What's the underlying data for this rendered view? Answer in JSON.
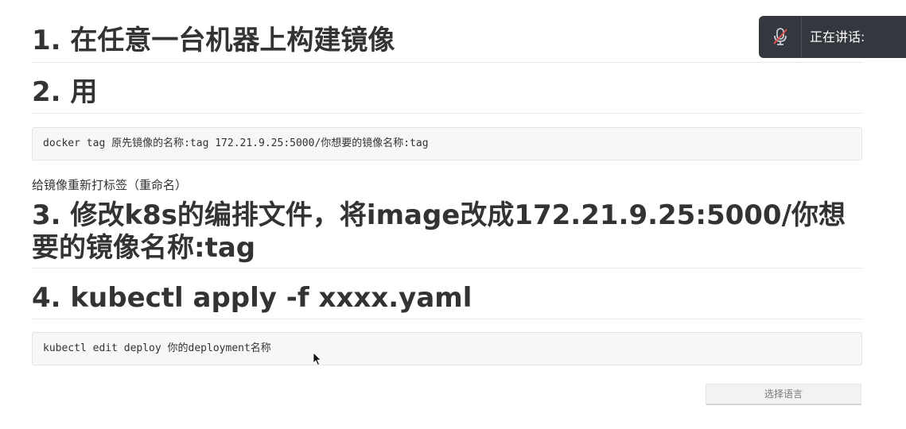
{
  "headings": {
    "h1": "1. 在任意一台机器上构建镜像",
    "h2": "2. 用",
    "h3": "3. 修改k8s的编排文件，将image改成172.21.9.25:5000/你想要的镜像名称:tag",
    "h4": "4. kubectl apply -f xxxx.yaml"
  },
  "code_blocks": {
    "tag_command": "docker tag 原先镜像的名称:tag 172.21.9.25:5000/你想要的镜像名称:tag",
    "edit_command": "kubectl edit deploy 你的deployment名称"
  },
  "paragraphs": {
    "retag_note": "给镜像重新打标签（重命名）"
  },
  "speaking_panel": {
    "label": "正在讲话:",
    "mic_icon": "mic-muted-icon",
    "background": "#34383e"
  },
  "language_select": {
    "label": "选择语言"
  },
  "icons": {
    "cursor": "mouse-pointer-icon"
  }
}
